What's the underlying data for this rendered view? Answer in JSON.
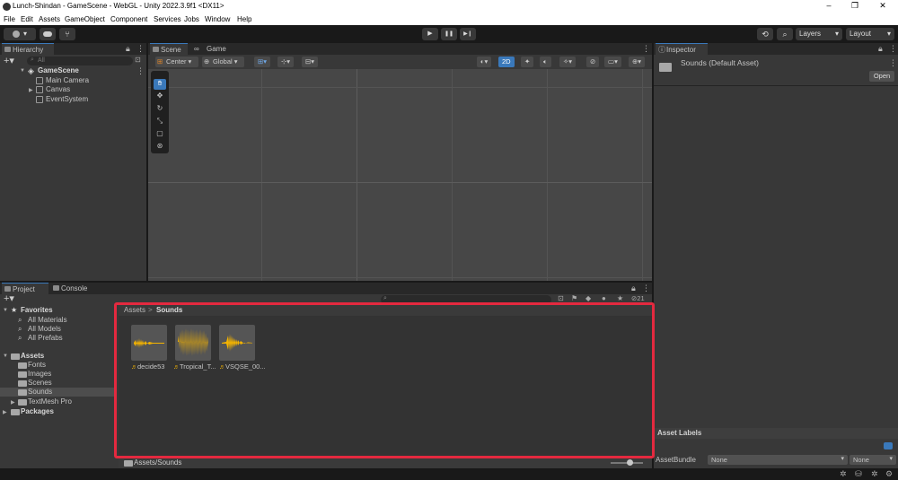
{
  "window": {
    "title": "Lunch-Shindan - GameScene - WebGL - Unity 2022.3.9f1 <DX11>",
    "minimize": "–",
    "maximize": "❐",
    "close": "✕"
  },
  "menu": [
    "File",
    "Edit",
    "Assets",
    "GameObject",
    "Component",
    "Services",
    "Jobs",
    "Window",
    "Help"
  ],
  "toolbar": {
    "account_caret": "▾",
    "play": "▶",
    "pause": "❚❚",
    "step": "▶❙",
    "layers": "Layers",
    "layout": "Layout"
  },
  "hierarchy": {
    "tab": "Hierarchy",
    "search_placeholder": "All",
    "scene": "GameScene",
    "items": [
      "Main Camera",
      "Canvas",
      "EventSystem"
    ]
  },
  "scene": {
    "tabs": [
      "Scene",
      "Game"
    ],
    "pivot": "Center",
    "space": "Global",
    "mode_2d": "2D"
  },
  "inspector": {
    "tab": "Inspector",
    "asset_title": "Sounds (Default Asset)",
    "open_button": "Open",
    "asset_labels": "Asset Labels",
    "asset_bundle_label": "AssetBundle",
    "bundle_value": "None",
    "variant_value": "None"
  },
  "project": {
    "tabs": [
      "Project",
      "Console"
    ],
    "hidden_count": "21",
    "favorites": {
      "label": "Favorites",
      "items": [
        "All Materials",
        "All Models",
        "All Prefabs"
      ]
    },
    "assets": {
      "label": "Assets",
      "items": [
        "Fonts",
        "Images",
        "Scenes",
        "Sounds",
        "TextMesh Pro"
      ]
    },
    "packages": "Packages",
    "breadcrumb": {
      "root": "Assets",
      "sep": ">",
      "current": "Sounds"
    },
    "files": [
      "decide53",
      "Tropical_T...",
      "VSQSE_00..."
    ],
    "footer_path": "Assets/Sounds"
  },
  "colors": {
    "highlight_border": "#e4293f",
    "waveform": "#f5b400",
    "accent": "#3a79bb"
  }
}
